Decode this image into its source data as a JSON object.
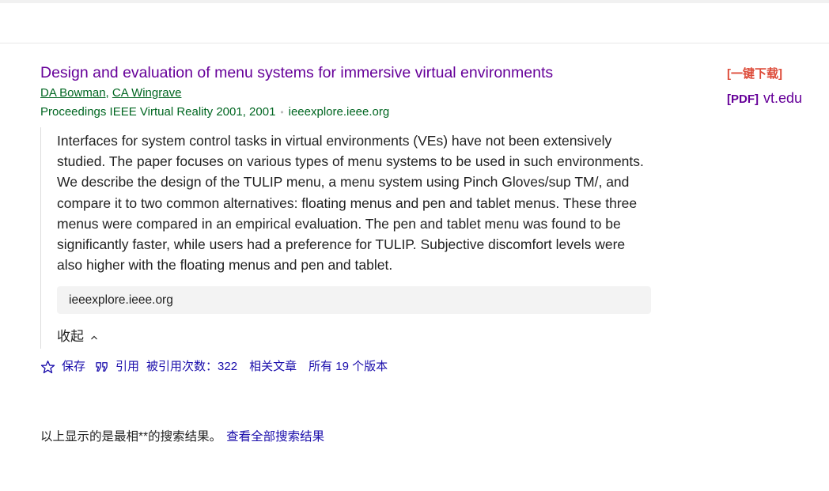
{
  "result": {
    "title": "Design and evaluation of menu systems for immersive virtual environments",
    "authors": [
      "DA Bowman",
      "CA Wingrave"
    ],
    "author_separator": ", ",
    "venue": "Proceedings IEEE Virtual Reality 2001, 2001",
    "domain": "ieeexplore.ieee.org",
    "abstract": "Interfaces for system control tasks in virtual environments (VEs) have not been extensively studied. The paper focuses on various types of menu systems to be used in such environments. We describe the design of the TULIP menu, a menu system using Pinch Gloves/sup TM/, and compare it to two common alternatives: floating menus and pen and tablet menus. These three menus were compared in an empirical evaluation. The pen and tablet menu was found to be significantly faster, while users had a preference for TULIP. Subjective discomfort levels were also higher with the floating menus and pen and tablet.",
    "site_box": "ieeexplore.ieee.org",
    "collapse_label": "收起",
    "actions": {
      "save": "保存",
      "cite": "引用",
      "cited_by": "被引用次数：322",
      "related": "相关文章",
      "versions": "所有 19 个版本"
    }
  },
  "side": {
    "download": "[一键下载]",
    "pdf_tag": "[PDF]",
    "pdf_domain": "vt.edu"
  },
  "summary": {
    "text": "以上显示的是最相**的搜索结果。",
    "link": "查看全部搜索结果"
  },
  "colors": {
    "title": "#660099",
    "green": "#006621",
    "link_blue": "#1a0dab",
    "download_red": "#dd4b39"
  },
  "icons": {
    "save": "star-outline-icon",
    "cite": "quote-icon",
    "collapse": "chevron-up-icon"
  }
}
